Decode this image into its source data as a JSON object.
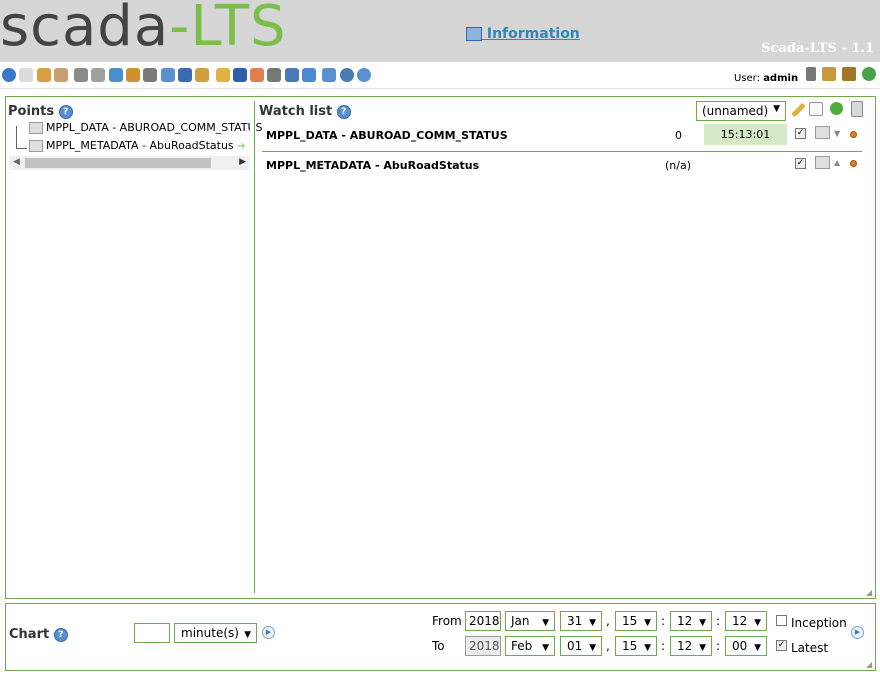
{
  "header": {
    "logo_part1": "scada",
    "logo_part2": "-LTS",
    "info_link": " Information",
    "version": "Scada-LTS - 1.1"
  },
  "toolbar": {
    "icons": [
      "watch-list-icon",
      "graphical-views-icon",
      "alarms-icon",
      "reports-icon",
      "data-sources-icon",
      "publishers-icon",
      "scheduled-events-icon",
      "event-handlers-icon",
      "point-links-icon",
      "scripting-icon",
      "users-icon",
      "user-profile-icon",
      "point-hierarchy-icon",
      "mailing-lists-icon",
      "maintenance-events-icon",
      "system-settings-icon",
      "sql-icon",
      "export-import-icon",
      "emport-icon",
      "logout-icon",
      "help-icon"
    ],
    "user_label": "User:",
    "user_name": "admin"
  },
  "points_panel": {
    "title": "Points",
    "tree": [
      {
        "label": "MPPL_DATA - ABUROAD_COMM_STATUS"
      },
      {
        "label": "MPPL_METADATA - AbuRoadStatus"
      }
    ]
  },
  "watch_list": {
    "title": "Watch list",
    "selected": "(unnamed)",
    "rows": [
      {
        "name": "MPPL_DATA - ABUROAD_COMM_STATUS",
        "value": "0",
        "time": "15:13:01",
        "checked": true
      },
      {
        "name": "MPPL_METADATA - AbuRoadStatus",
        "value": "(n/a)",
        "time": "",
        "checked": true
      }
    ]
  },
  "chart_panel": {
    "title": "Chart",
    "period_value": "",
    "period_unit": "minute(s)",
    "from_label": "From",
    "to_label": "To",
    "from": {
      "year": "2018",
      "month": "Jan",
      "day": "31",
      "hour": "15",
      "minute": "12",
      "second": "12"
    },
    "to": {
      "year": "2018",
      "month": "Feb",
      "day": "01",
      "hour": "15",
      "minute": "12",
      "second": "00"
    },
    "comma": ",",
    "colon": ":",
    "inception_label": "Inception",
    "inception_checked": false,
    "latest_label": "Latest",
    "latest_checked": true
  },
  "colors": {
    "accent_green": "#6fa84e",
    "link_blue": "#2a8ab4",
    "header_gray": "#d6d6d6"
  }
}
